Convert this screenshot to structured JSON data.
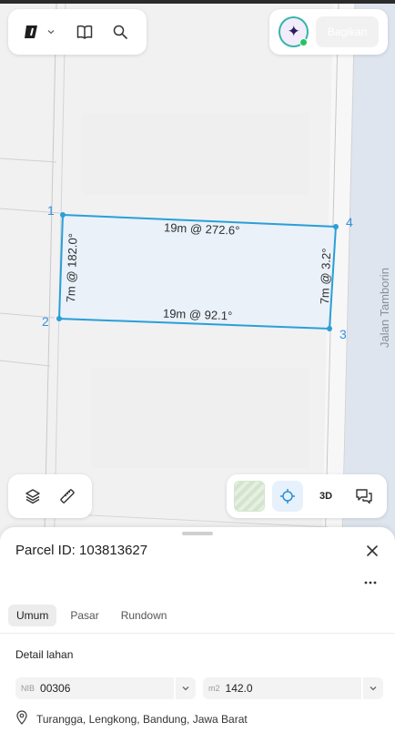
{
  "toolbar": {
    "logo_icon": "logo-mark-icon",
    "dropdown_icon": "chevron-down-icon",
    "book_icon": "book-open-icon",
    "search_icon": "search-icon"
  },
  "account": {
    "avatar_icon": "sparkle-icon",
    "share_label": "Bagikan"
  },
  "map": {
    "road_name": "Jalan Tamborin",
    "vertices": [
      "1",
      "2",
      "3",
      "4"
    ],
    "edges": {
      "top": "19m @ 272.6°",
      "bottom": "19m @ 92.1°",
      "left": "7m @ 182.0°",
      "right": "7m @ 3.2°"
    },
    "colors": {
      "parcel_stroke": "#2a9fd8",
      "parcel_fill": "#eaf1f9",
      "vertex_label": "#3a8fd8"
    }
  },
  "map_controls": {
    "layers_icon": "layers-icon",
    "measure_icon": "ruler-icon",
    "basemap_thumb": "satellite-thumbnail",
    "locate_icon": "crosshair-icon",
    "view_3d_label": "3D",
    "feedback_icon": "chat-bubbles-icon"
  },
  "sheet": {
    "title": "Parcel ID: 103813627",
    "tabs": [
      {
        "label": "Umum",
        "active": true
      },
      {
        "label": "Pasar",
        "active": false
      },
      {
        "label": "Rundown",
        "active": false
      }
    ],
    "section_title": "Detail lahan",
    "nib": {
      "prefix": "NIB",
      "value": "00306"
    },
    "area": {
      "prefix": "m2",
      "value": "142.0"
    },
    "address": "Turangga, Lengkong, Bandung, Jawa Barat"
  }
}
